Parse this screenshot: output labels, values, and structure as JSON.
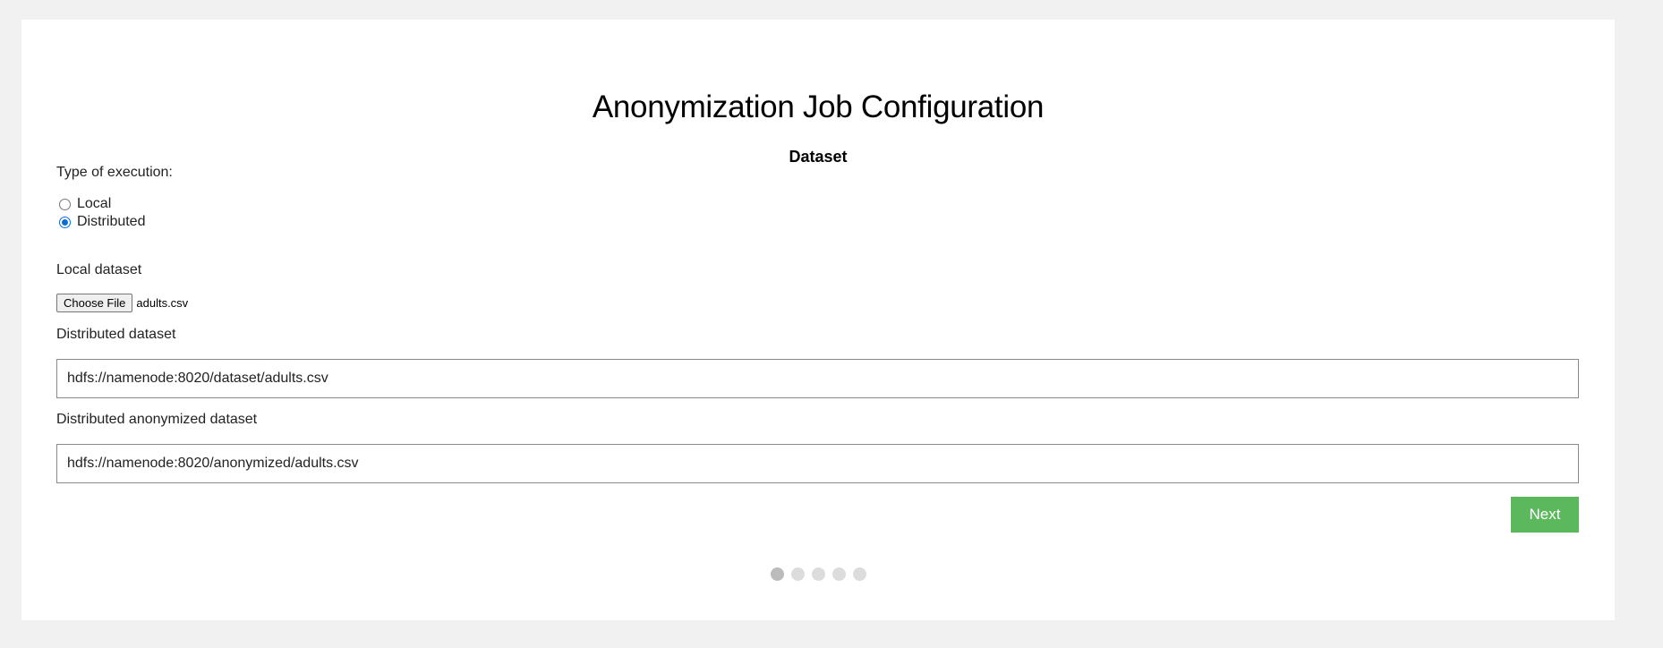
{
  "page": {
    "title": "Anonymization Job Configuration",
    "subtitle": "Dataset"
  },
  "execution": {
    "label": "Type of execution:",
    "options": [
      {
        "label": "Local",
        "checked": false
      },
      {
        "label": "Distributed",
        "checked": true
      }
    ]
  },
  "local_dataset": {
    "label": "Local dataset",
    "button_label": "Choose File",
    "file_name": "adults.csv"
  },
  "distributed_dataset": {
    "label": "Distributed dataset",
    "value": "hdfs://namenode:8020/dataset/adults.csv"
  },
  "distributed_anonymized_dataset": {
    "label": "Distributed anonymized dataset",
    "value": "hdfs://namenode:8020/anonymized/adults.csv"
  },
  "next_button": "Next",
  "steps": {
    "total": 5,
    "current": 1
  },
  "colors": {
    "background": "#f1f1f1",
    "card": "#ffffff",
    "next_button": "#5cb85c",
    "radio_accent": "#0a6cd6",
    "step_active": "#bbbbbb",
    "step_inactive": "#dcdcdc"
  }
}
